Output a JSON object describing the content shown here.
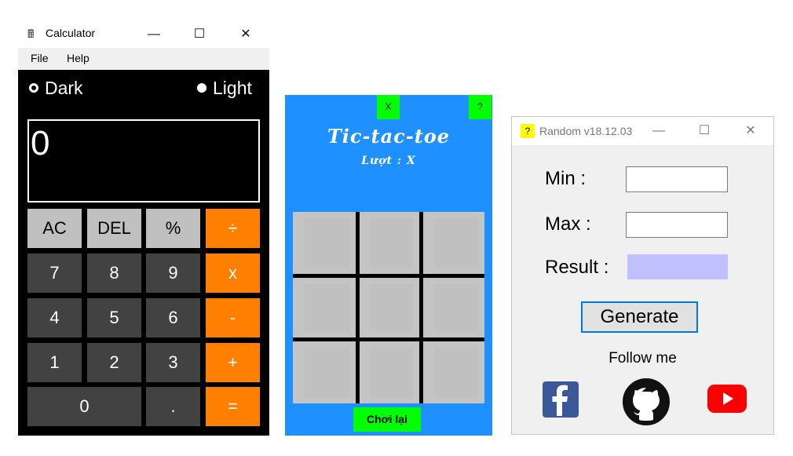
{
  "calculator": {
    "title": "Calculator",
    "menu": [
      "File",
      "Help"
    ],
    "theme_dark": "Dark",
    "theme_light": "Light",
    "display": "0",
    "buttons": [
      "AC",
      "DEL",
      "%",
      "÷",
      "7",
      "8",
      "9",
      "x",
      "4",
      "5",
      "6",
      "-",
      "1",
      "2",
      "3",
      "+",
      "0",
      ".",
      "="
    ],
    "colors": {
      "bg": "#000000",
      "digit": "#424242",
      "function": "#c0c0c0",
      "operator": "#ff7f00"
    }
  },
  "tictactoe": {
    "close_label": "X",
    "help_label": "?",
    "title": "Tic-tac-toe",
    "turn": "Lượt : X",
    "replay": "Chơi lại",
    "colors": {
      "bg": "#1e90ff",
      "accent": "#00ff00",
      "cell": "#c4c4c4"
    }
  },
  "random": {
    "icon_label": "?",
    "title": "Random v18.12.03",
    "min_label": "Min  :",
    "max_label": "Max :",
    "result_label": "Result :",
    "min_value": "",
    "max_value": "",
    "generate": "Generate",
    "follow": "Follow me",
    "social": [
      "facebook-icon",
      "github-icon",
      "youtube-icon"
    ],
    "colors": {
      "result_bg": "#c0c0ff",
      "button_border": "#0078d7"
    }
  }
}
